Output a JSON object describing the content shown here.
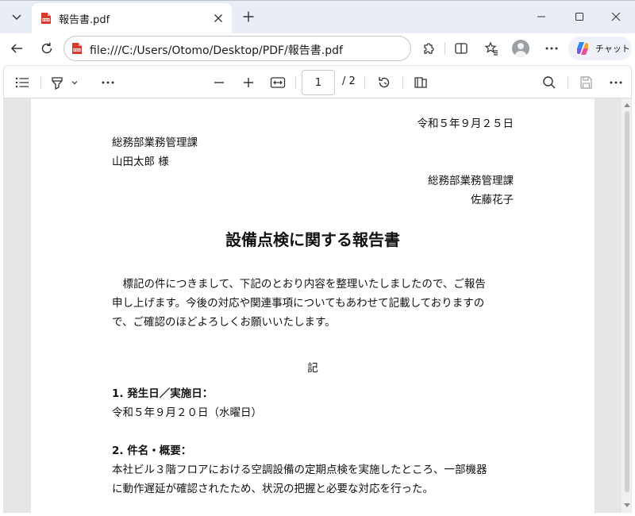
{
  "tab": {
    "title": "報告書.pdf"
  },
  "address": {
    "url": "file:///C:/Users/Otomo/Desktop/PDF/報告書.pdf"
  },
  "copilot": {
    "label": "チャット"
  },
  "pdf_toolbar": {
    "current_page": "1",
    "total_pages": "/ 2"
  },
  "document": {
    "date": "令和５年９月２５日",
    "recipient_dept": "総務部業務管理課",
    "recipient_name": "山田太郎 様",
    "sender_dept": "総務部業務管理課",
    "sender_name": "佐藤花子",
    "title": "設備点検に関する報告書",
    "intro_lines": [
      "　標記の件につきまして、下記のとおり内容を整理いたしましたので、ご報告",
      "申し上げます。今後の対応や関連事項についてもあわせて記載しておりますの",
      "で、ご確認のほどよろしくお願いいたします。"
    ],
    "ki": "記",
    "sections": [
      {
        "heading": "1. 発生日／実施日：",
        "lines": [
          "令和５年９月２０日（水曜日）"
        ]
      },
      {
        "heading": "2. 件名・概要：",
        "lines": [
          "本社ビル３階フロアにおける空調設備の定期点検を実施したところ、一部機器",
          "に動作遅延が確認されたため、状況の把握と必要な対応を行った。"
        ]
      }
    ]
  },
  "colors": {
    "tabbar_bg": "#e9eef6",
    "pdf_red": "#d83b2e",
    "viewer_bg": "#e6e6e6"
  }
}
